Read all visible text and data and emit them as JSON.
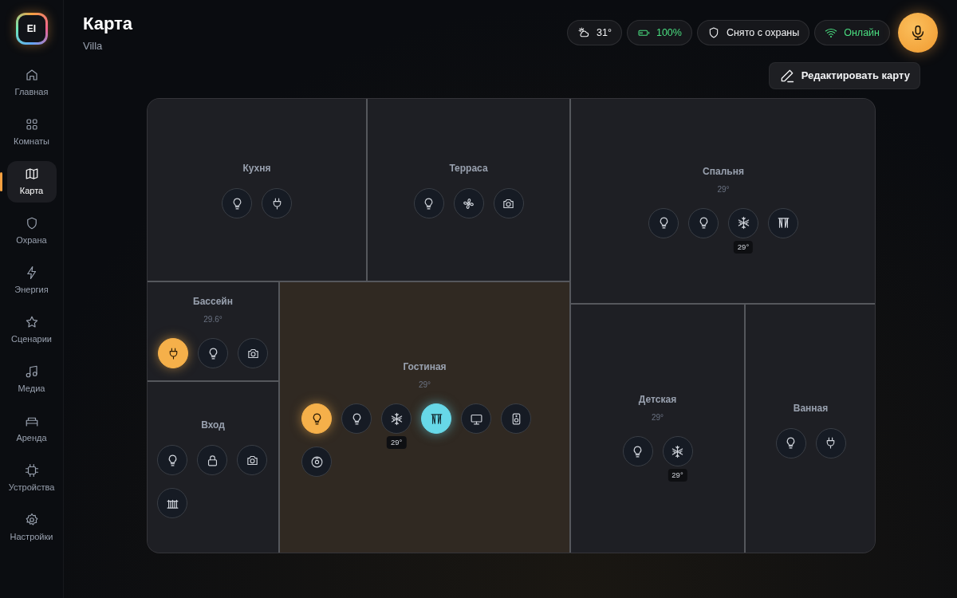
{
  "logo": "EI",
  "sidebar": {
    "items": [
      {
        "label": "Главная",
        "kind": "home",
        "selected": false
      },
      {
        "label": "Комнаты",
        "kind": "rooms",
        "selected": false
      },
      {
        "label": "Карта",
        "kind": "map",
        "selected": true
      },
      {
        "label": "Охрана",
        "kind": "security",
        "selected": false
      },
      {
        "label": "Энергия",
        "kind": "energy",
        "selected": false
      },
      {
        "label": "Сценарии",
        "kind": "scenes",
        "selected": false
      },
      {
        "label": "Медиа",
        "kind": "media",
        "selected": false
      },
      {
        "label": "Аренда",
        "kind": "rental",
        "selected": false
      },
      {
        "label": "Устройства",
        "kind": "devices",
        "selected": false
      },
      {
        "label": "Настройки",
        "kind": "settings",
        "selected": false
      }
    ]
  },
  "header": {
    "title": "Карта",
    "subtitle": "Villa"
  },
  "status": [
    {
      "kind": "weather",
      "text": "31°"
    },
    {
      "kind": "battery",
      "text": "100%"
    },
    {
      "kind": "security",
      "text": "Снято с охраны"
    },
    {
      "kind": "network",
      "text": "Онлайн"
    }
  ],
  "edit_button": "Редактировать карту",
  "rooms": [
    {
      "name": "Кухня",
      "selected": false,
      "devices": [
        {
          "kind": "bulb",
          "on": false
        },
        {
          "kind": "plug",
          "on": false
        }
      ]
    },
    {
      "name": "Терраса",
      "selected": false,
      "devices": [
        {
          "kind": "bulb",
          "on": false
        },
        {
          "kind": "fan",
          "on": false
        },
        {
          "kind": "camera",
          "on": false
        }
      ]
    },
    {
      "name": "Спальня",
      "temperature": "29°",
      "selected": false,
      "devices": [
        {
          "kind": "bulb",
          "on": false
        },
        {
          "kind": "bulb",
          "on": false
        },
        {
          "kind": "ac",
          "on": false,
          "reading": "29°"
        },
        {
          "kind": "curtain",
          "on": false
        }
      ]
    },
    {
      "name": "Бассейн",
      "temperature": "29.6°",
      "selected": false,
      "devices": [
        {
          "kind": "plug",
          "on": true
        },
        {
          "kind": "bulb",
          "on": false
        },
        {
          "kind": "camera",
          "on": false
        }
      ]
    },
    {
      "name": "Вход",
      "selected": false,
      "devices": [
        {
          "kind": "bulb",
          "on": false
        },
        {
          "kind": "lock",
          "on": false
        },
        {
          "kind": "camera",
          "on": false
        },
        {
          "kind": "gate",
          "on": false
        }
      ]
    },
    {
      "name": "Гостиная",
      "temperature": "29°",
      "selected": true,
      "devices": [
        {
          "kind": "bulb",
          "on": true
        },
        {
          "kind": "bulb",
          "on": false
        },
        {
          "kind": "ac",
          "on": false,
          "reading": "29°"
        },
        {
          "kind": "curtain",
          "on": true
        },
        {
          "kind": "tv",
          "on": false
        },
        {
          "kind": "speaker",
          "on": false
        },
        {
          "kind": "vacuum",
          "on": false
        }
      ]
    },
    {
      "name": "Детская",
      "temperature": "29°",
      "selected": false,
      "devices": [
        {
          "kind": "bulb",
          "on": false
        },
        {
          "kind": "ac",
          "on": false,
          "reading": "29°"
        }
      ]
    },
    {
      "name": "Ванная",
      "selected": false,
      "devices": [
        {
          "kind": "bulb",
          "on": false
        },
        {
          "kind": "plug",
          "on": false
        }
      ]
    }
  ]
}
